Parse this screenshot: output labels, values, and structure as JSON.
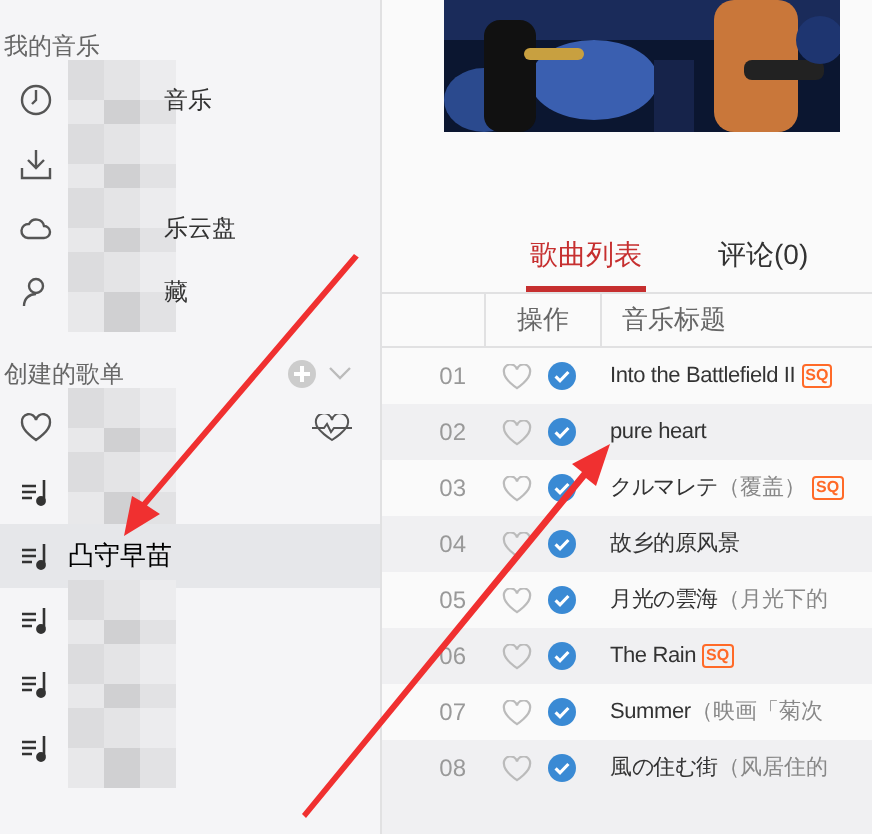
{
  "sidebar": {
    "sections": [
      {
        "title": "我的音乐",
        "actions": false,
        "items": [
          {
            "kind": "clock",
            "label": "音乐",
            "blurred": true,
            "selected": false
          },
          {
            "kind": "download",
            "blurred": true,
            "selected": false
          },
          {
            "kind": "cloud",
            "label": "乐云盘",
            "blurred": true,
            "selected": false
          },
          {
            "kind": "person",
            "label": "藏",
            "blurred": true,
            "selected": false
          }
        ]
      },
      {
        "title": "创建的歌单",
        "actions": true,
        "items": [
          {
            "kind": "heart",
            "blurred": true,
            "selected": false
          },
          {
            "kind": "playlist",
            "blurred": true,
            "selected": false
          },
          {
            "kind": "playlist",
            "label": "凸守早苗",
            "blurred": false,
            "selected": true
          },
          {
            "kind": "playlist",
            "blurred": true,
            "selected": false
          },
          {
            "kind": "playlist",
            "blurred": true,
            "selected": false
          },
          {
            "kind": "playlist",
            "blurred": true,
            "selected": false
          }
        ]
      }
    ]
  },
  "tabs": [
    {
      "label": "歌曲列表",
      "selected": true
    },
    {
      "label": "评论(0)",
      "selected": false
    }
  ],
  "table": {
    "columns": [
      "",
      "操作",
      "音乐标题"
    ],
    "rows": [
      {
        "number": "01",
        "liked": false,
        "downloaded": true,
        "title": {
          "text": "Into the Battlefield II",
          "badge": "SQ"
        }
      },
      {
        "number": "02",
        "liked": false,
        "downloaded": true,
        "title": {
          "text": "pure heart"
        }
      },
      {
        "number": "03",
        "liked": false,
        "downloaded": true,
        "title": {
          "text": "クルマレテ",
          "subtitle": "（覆盖）",
          "badge": "SQ"
        }
      },
      {
        "number": "04",
        "liked": false,
        "downloaded": true,
        "title": {
          "text": "故乡的原风景"
        }
      },
      {
        "number": "05",
        "liked": false,
        "downloaded": true,
        "title": {
          "text": "月光の雲海",
          "subtitle": "（月光下的"
        }
      },
      {
        "number": "06",
        "liked": false,
        "downloaded": true,
        "title": {
          "text": "The Rain",
          "badge": "SQ"
        }
      },
      {
        "number": "07",
        "liked": false,
        "downloaded": true,
        "title": {
          "text": "Summer",
          "subtitle": "（映画「菊次"
        }
      },
      {
        "number": "08",
        "liked": false,
        "downloaded": true,
        "title": {
          "text": "風の住む街",
          "subtitle": "（风居住的"
        }
      }
    ]
  }
}
